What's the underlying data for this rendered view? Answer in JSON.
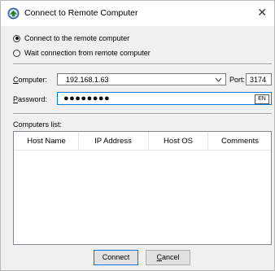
{
  "window": {
    "title": "Connect to Remote Computer",
    "close_glyph": "✕"
  },
  "mode": {
    "option_connect": "Connect to the remote computer",
    "option_wait": "Wait connection from remote computer",
    "selected": "connect"
  },
  "computer": {
    "label_accel": "C",
    "label_rest": "omputer:",
    "value": "192.168.1.63"
  },
  "port": {
    "label_accel": "P",
    "label_rest": "ort:",
    "value": "3174"
  },
  "password": {
    "label_accel": "P",
    "label_rest": "assword:",
    "masked": "●●●●●●●●",
    "lang_indicator": "EN"
  },
  "computers_list": {
    "label": "Computers list:",
    "columns": [
      "Host Name",
      "IP Address",
      "Host OS",
      "Comments"
    ]
  },
  "buttons": {
    "connect": "Connect",
    "cancel_accel": "C",
    "cancel_rest": "ancel"
  },
  "icons": {
    "app": "teamviewer-like-app-icon",
    "close": "close-icon",
    "dropdown": "chevron-down-icon"
  }
}
